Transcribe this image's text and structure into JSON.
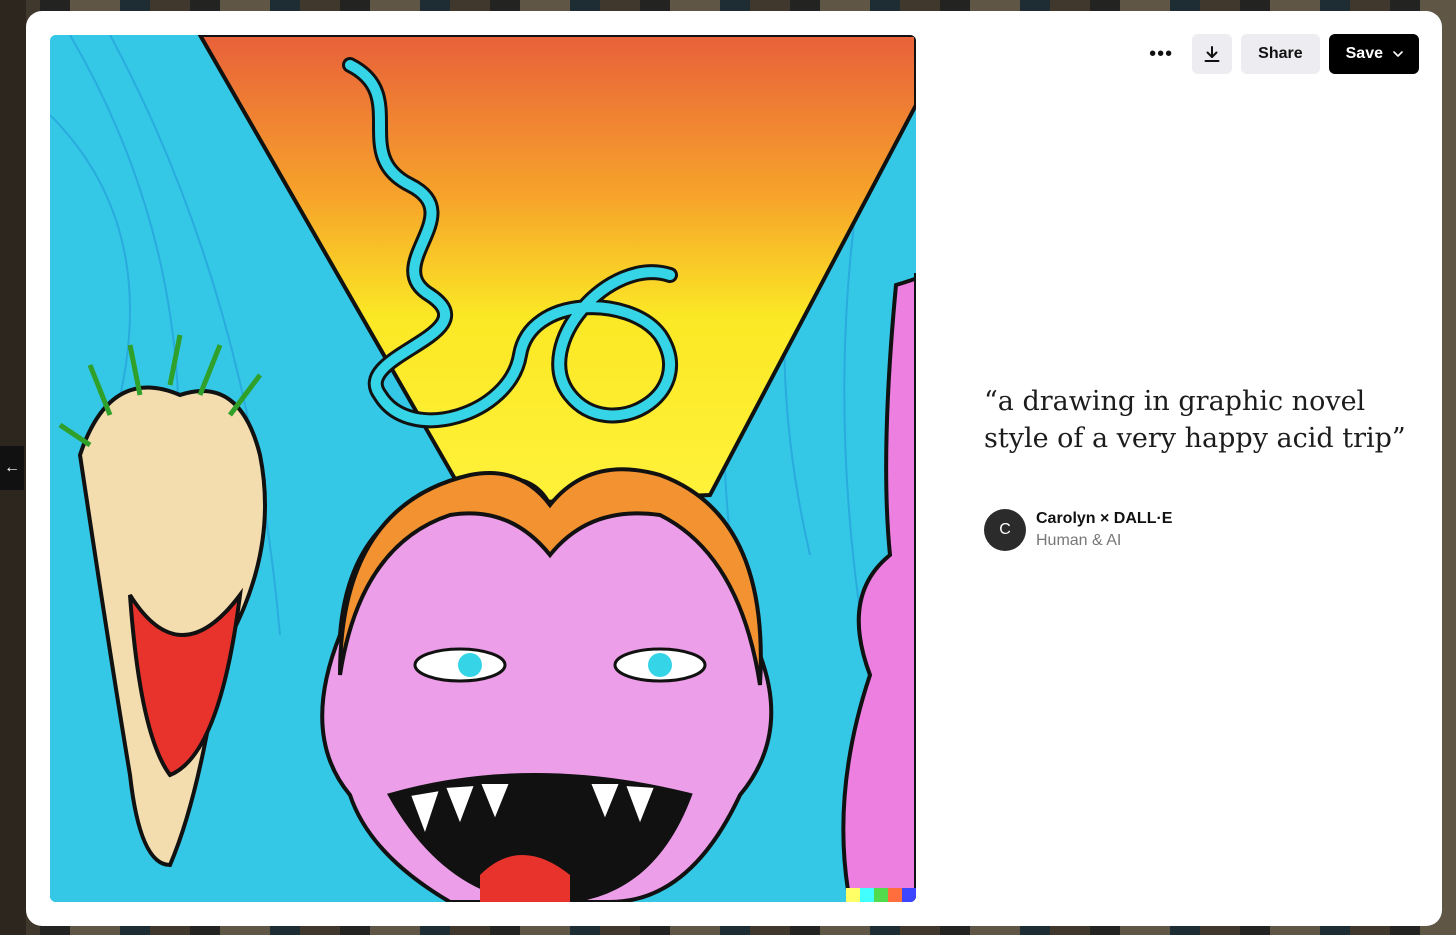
{
  "modal": {
    "toolbar": {
      "more_icon": "more-horizontal-icon",
      "download_icon": "download-icon",
      "share_label": "Share",
      "save_label": "Save",
      "save_caret_icon": "chevron-down-icon"
    },
    "prompt": "“a drawing in graphic novel style of a very happy acid trip”",
    "author": {
      "avatar_initial": "C",
      "name": "Carolyn × DALL·E",
      "subtitle": "Human & AI"
    },
    "artwork": {
      "signature_colors": [
        "#ffff66",
        "#42ffff",
        "#51da4c",
        "#ff6e3c",
        "#3c46ff"
      ]
    }
  },
  "nav": {
    "prev_icon": "arrow-left-icon"
  }
}
